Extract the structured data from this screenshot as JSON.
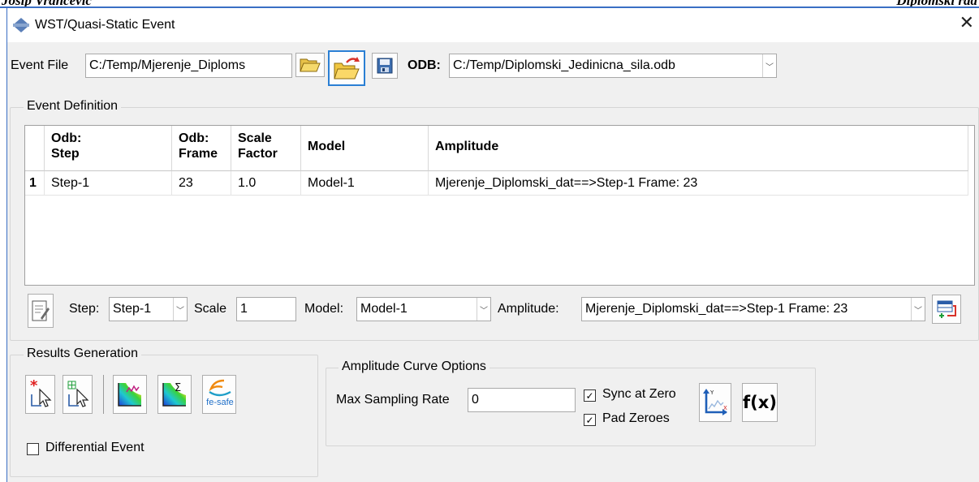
{
  "document": {
    "header_left": "Josip Vrančević",
    "header_right": "Diplomski rad"
  },
  "window": {
    "title": "WST/Quasi-Static Event",
    "close_glyph": "✕"
  },
  "toolbar": {
    "event_file_label": "Event File",
    "event_file_value": "C:/Temp/Mjerenje_Diploms",
    "odb_label": "ODB:",
    "odb_value": "C:/Temp/Diplomski_Jedinicna_sila.odb",
    "icons": [
      "open-folder-icon",
      "open-event-file-icon",
      "save-icon"
    ]
  },
  "event_definition": {
    "title": "Event Definition",
    "columns": [
      {
        "line1": "",
        "line2": ""
      },
      {
        "line1": "Odb:",
        "line2": "Step"
      },
      {
        "line1": "Odb:",
        "line2": "Frame"
      },
      {
        "line1": "Scale",
        "line2": "Factor"
      },
      {
        "line1": "Model",
        "line2": ""
      },
      {
        "line1": "Amplitude",
        "line2": ""
      }
    ],
    "rows": [
      {
        "index": "1",
        "step": "Step-1",
        "frame": "23",
        "scale": "1.0",
        "model": "Model-1",
        "amplitude": "Mjerenje_Diplomski_dat==>Step-1 Frame: 23"
      }
    ],
    "editor": {
      "step_label": "Step:",
      "step_value": "Step-1",
      "scale_label": "Scale",
      "scale_value": "1",
      "model_label": "Model:",
      "model_value": "Model-1",
      "amplitude_label": "Amplitude:",
      "amplitude_value": "Mjerenje_Diplomski_dat==>Step-1 Frame: 23"
    }
  },
  "results_generation": {
    "title": "Results Generation",
    "differential_event_label": "Differential Event",
    "differential_event_checked": false,
    "fe_safe_text": "fe-safe"
  },
  "amplitude_curve_options": {
    "title": "Amplitude Curve Options",
    "max_sampling_rate_label": "Max Sampling Rate",
    "max_sampling_rate_value": "0",
    "sync_at_zero_label": "Sync at Zero",
    "sync_at_zero_checked": true,
    "pad_zeroes_label": "Pad Zeroes",
    "pad_zeroes_checked": true,
    "fx_label": "f(x)"
  },
  "colors": {
    "accent_blue": "#2a7fd4",
    "dialog_bg": "#f0f0f0",
    "doc_rule": "#3a6fc4"
  }
}
